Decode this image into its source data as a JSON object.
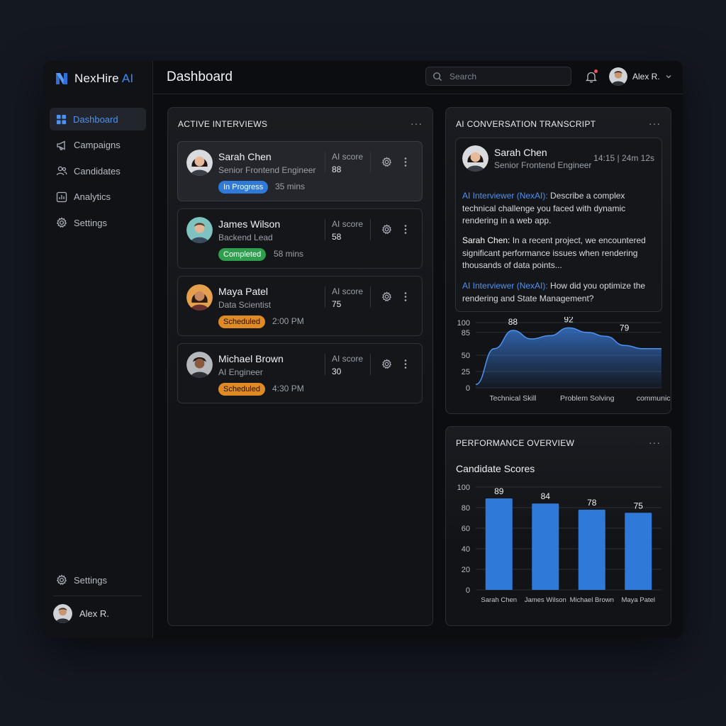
{
  "brand": {
    "name": "NexHire",
    "accent": "AI",
    "accent_color": "#3b8cf0"
  },
  "sidebar": {
    "items": [
      {
        "label": "Dashboard",
        "icon": "grid-icon",
        "active": true
      },
      {
        "label": "Campaigns",
        "icon": "megaphone-icon"
      },
      {
        "label": "Candidates",
        "icon": "users-icon"
      },
      {
        "label": "Analytics",
        "icon": "bar-chart-icon"
      },
      {
        "label": "Settings",
        "icon": "gear-icon"
      }
    ],
    "bottom_settings": "Settings",
    "user_name": "Alex R."
  },
  "header": {
    "title": "Dashboard",
    "search_placeholder": "Search",
    "user_name": "Alex R."
  },
  "interviews": {
    "title": "ACTIVE INTERVIEWS",
    "more": "···",
    "score_label": "AI score",
    "cards": [
      {
        "name": "Sarah Chen",
        "role": "Senior Frontend Engineer",
        "score": "88",
        "status": "In Progress",
        "meta": "35 mins"
      },
      {
        "name": "James Wilson",
        "role": "Backend Lead",
        "score": "58",
        "status": "Completed",
        "meta": "58 mins"
      },
      {
        "name": "Maya Patel",
        "role": "Data Scientist",
        "score": "75",
        "status": "Scheduled",
        "meta": "2:00 PM"
      },
      {
        "name": "Michael Brown",
        "role": "AI Engineer",
        "score": "30",
        "status": "Scheduled",
        "meta": "4:30 PM"
      }
    ]
  },
  "transcript": {
    "title": "AI CONVERSATION TRANSCRIPT",
    "more": "···",
    "candidate_name": "Sarah Chen",
    "candidate_role": "Senior Frontend Engineer",
    "time": "14:15 | 24m 12s",
    "messages": [
      {
        "speaker": "AI Interviewer (NexAI):",
        "text": " Describe a complex technical challenge you faced with dynamic rendering in a web app."
      },
      {
        "speaker": "Sarah Chen:",
        "text": " In a recent project, we encountered significant performance issues when rendering thousands of data points..."
      },
      {
        "speaker": "AI Interviewer (NexAI):",
        "text": " How did you optimize the rendering and State Management?"
      }
    ]
  },
  "performance": {
    "title": "PERFORMANCE OVERVIEW",
    "more": "···"
  },
  "chart_data": [
    {
      "type": "area",
      "title": "",
      "categories": [
        "Technical Skill",
        "Problem Solving",
        "communication"
      ],
      "x": [
        0,
        0.5,
        1,
        1.5,
        2,
        2.5,
        3,
        3.5,
        4,
        4.5,
        5
      ],
      "values": [
        5,
        60,
        88,
        75,
        80,
        92,
        85,
        79,
        65,
        60,
        60
      ],
      "labeled_points": [
        {
          "x": 1,
          "value": 88
        },
        {
          "x": 2.5,
          "value": 92
        },
        {
          "x": 4,
          "value": 79
        }
      ],
      "category_positions": [
        1,
        3,
        5
      ],
      "ylim": [
        0,
        100
      ],
      "yticks": [
        0,
        25,
        50,
        85,
        100
      ],
      "grid": true,
      "color": "#3b7fe0"
    },
    {
      "type": "bar",
      "title": "Candidate Scores",
      "categories": [
        "Sarah Chen",
        "James Wilson",
        "Michael Brown",
        "Maya Patel"
      ],
      "values": [
        89,
        84,
        78,
        75
      ],
      "ylim": [
        0,
        100
      ],
      "yticks": [
        0,
        20,
        40,
        60,
        80,
        100
      ],
      "grid": true,
      "color": "#2f7ad8"
    }
  ]
}
